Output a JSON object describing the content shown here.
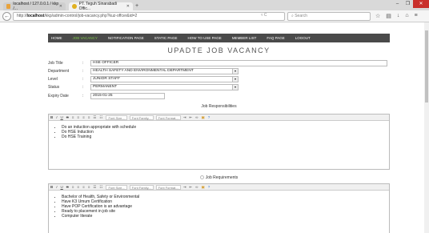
{
  "browser": {
    "tab1_title": "localhost / 127.0.0.1 / kkp /...",
    "tab2_title": "PT. Teguh Sinarabadi Offic...",
    "url_host": "localhost",
    "url_prefix": "http://",
    "url_path": "/kkp/admin-control/job-vacancy.php?kuz-offcer&id=2",
    "search_placeholder": "Search"
  },
  "menu": [
    "HOME",
    "JOB VACANCY",
    "NOTIFICATION PAGE",
    "STATIC PAGE",
    "HOW TO USE PAGE",
    "MEMBER LIST",
    "FAQ PAGE",
    "LOGOUT"
  ],
  "page_title": "UPADTE JOB VACANCY",
  "form": {
    "job_title": {
      "label": "Job Title",
      "value": "HSE OFFICER"
    },
    "department": {
      "label": "Department",
      "value": "HEALTH SAFETY AND ENVIRONMENTAL DEPARTMENT"
    },
    "level": {
      "label": "Level",
      "value": "JUNIOR STAFF"
    },
    "status": {
      "label": "Status",
      "value": "PERMANENT"
    },
    "expiry": {
      "label": "Expiry Date",
      "value": "2015-01-25"
    },
    "colon": ":"
  },
  "editor_toolbar": {
    "font_size": "Font Size...",
    "font_family": "Font Family...",
    "font_format": "Font Format..."
  },
  "responsibilities": {
    "heading": "Job Responsibilities",
    "items": [
      "Do an induction appropriate with schedule",
      "Do HSE Induction",
      "Do HSE Training"
    ]
  },
  "requirements": {
    "heading": "Job Requirements",
    "items": [
      "Bachelor of Health, Safety or Environmental",
      "Have K3 Umum Certification",
      "Have POP Certification is an advantage",
      "Ready to placement in job site",
      "Computer literate"
    ]
  }
}
